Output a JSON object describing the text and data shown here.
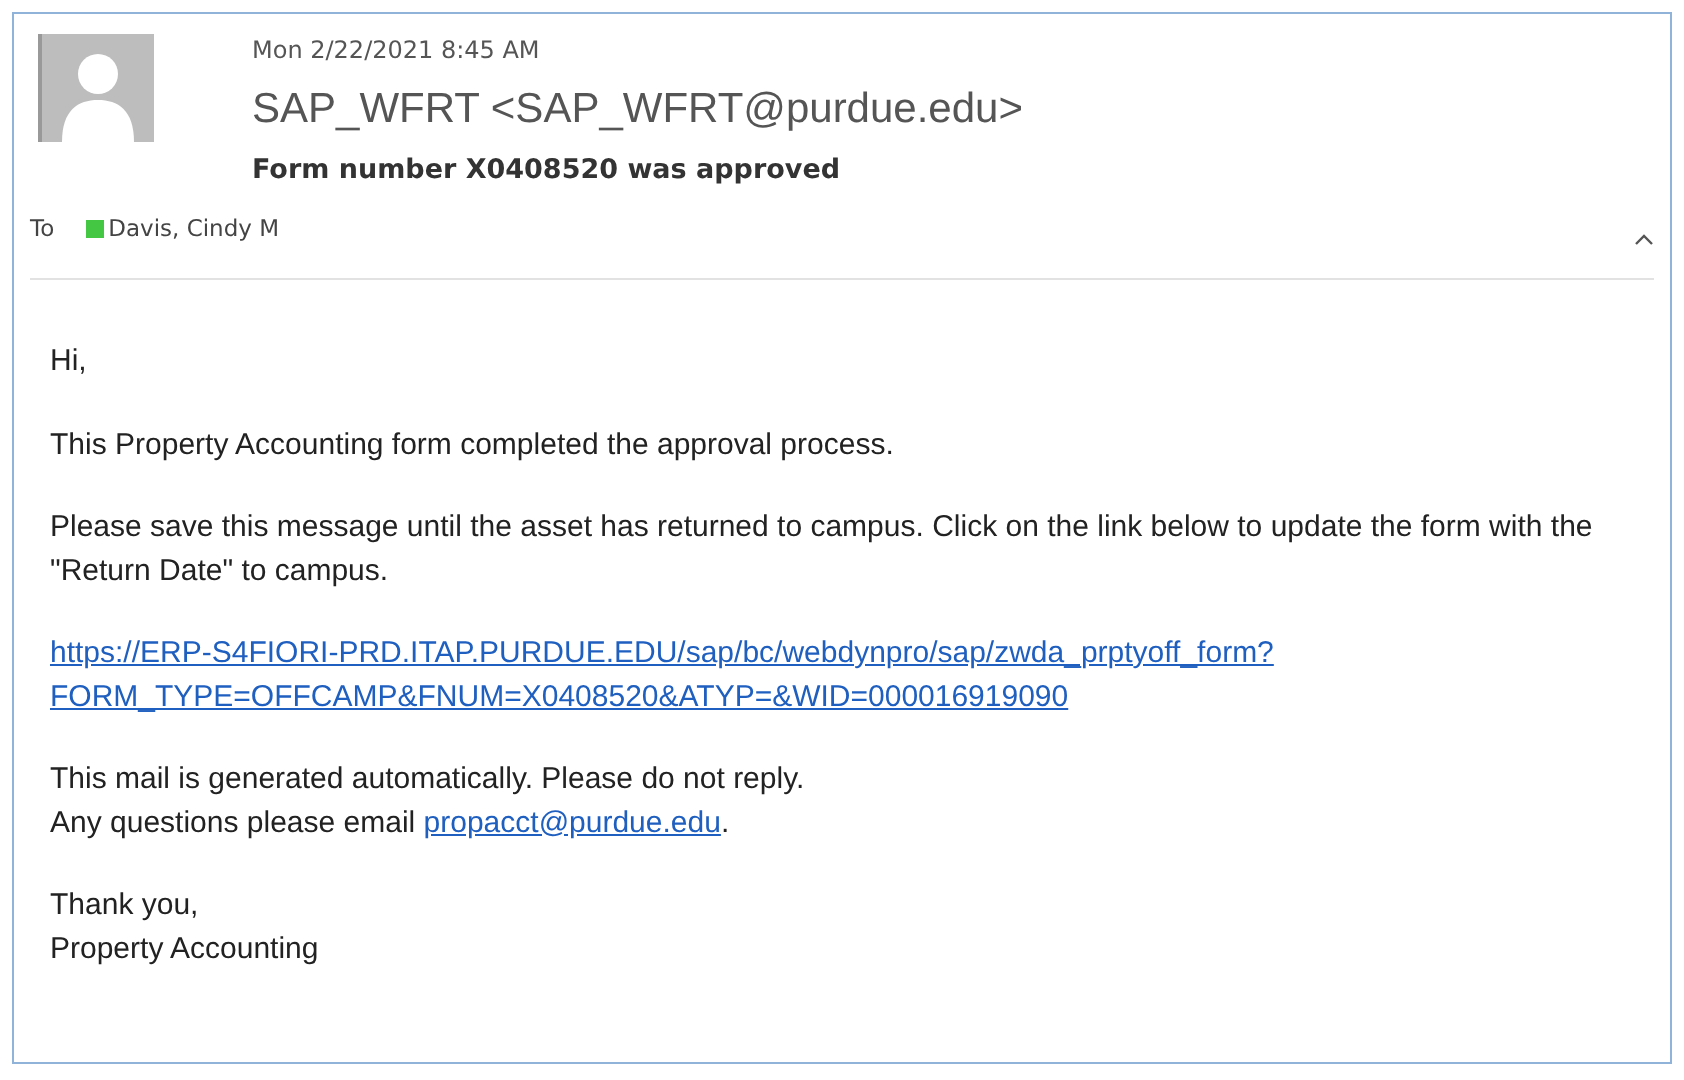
{
  "header": {
    "date": "Mon 2/22/2021 8:45 AM",
    "sender": "SAP_WFRT <SAP_WFRT@purdue.edu>",
    "subject": "Form number X0408520 was approved",
    "to_label": "To",
    "recipients": [
      {
        "name": "Davis, Cindy M",
        "color": "#44c844"
      }
    ]
  },
  "body": [
    {
      "kind": "text",
      "lines": [
        "Hi,"
      ]
    },
    {
      "kind": "text",
      "lines": [
        "This Property Accounting form completed the approval process."
      ]
    },
    {
      "kind": "text",
      "lines": [
        "Please save this message until the asset has returned to campus. Click on the link below to update the form with the \"Return Date\" to campus."
      ]
    },
    {
      "kind": "link",
      "lines": [
        "https://ERP-S4FIORI-PRD.ITAP.PURDUE.EDU/sap/bc/webdynpro/sap/zwda_prptyoff_form?",
        "FORM_TYPE=OFFCAMP&FNUM=X0408520&ATYP=&WID=000016919090"
      ]
    },
    {
      "kind": "text",
      "lines": [
        "This mail is generated automatically. Please do not reply."
      ]
    },
    {
      "kind": "mixed",
      "before": "Any questions please email ",
      "link": "propacct@purdue.edu",
      "after": "."
    },
    {
      "kind": "text",
      "lines": [
        "Thank you,",
        "Property Accounting"
      ]
    }
  ]
}
